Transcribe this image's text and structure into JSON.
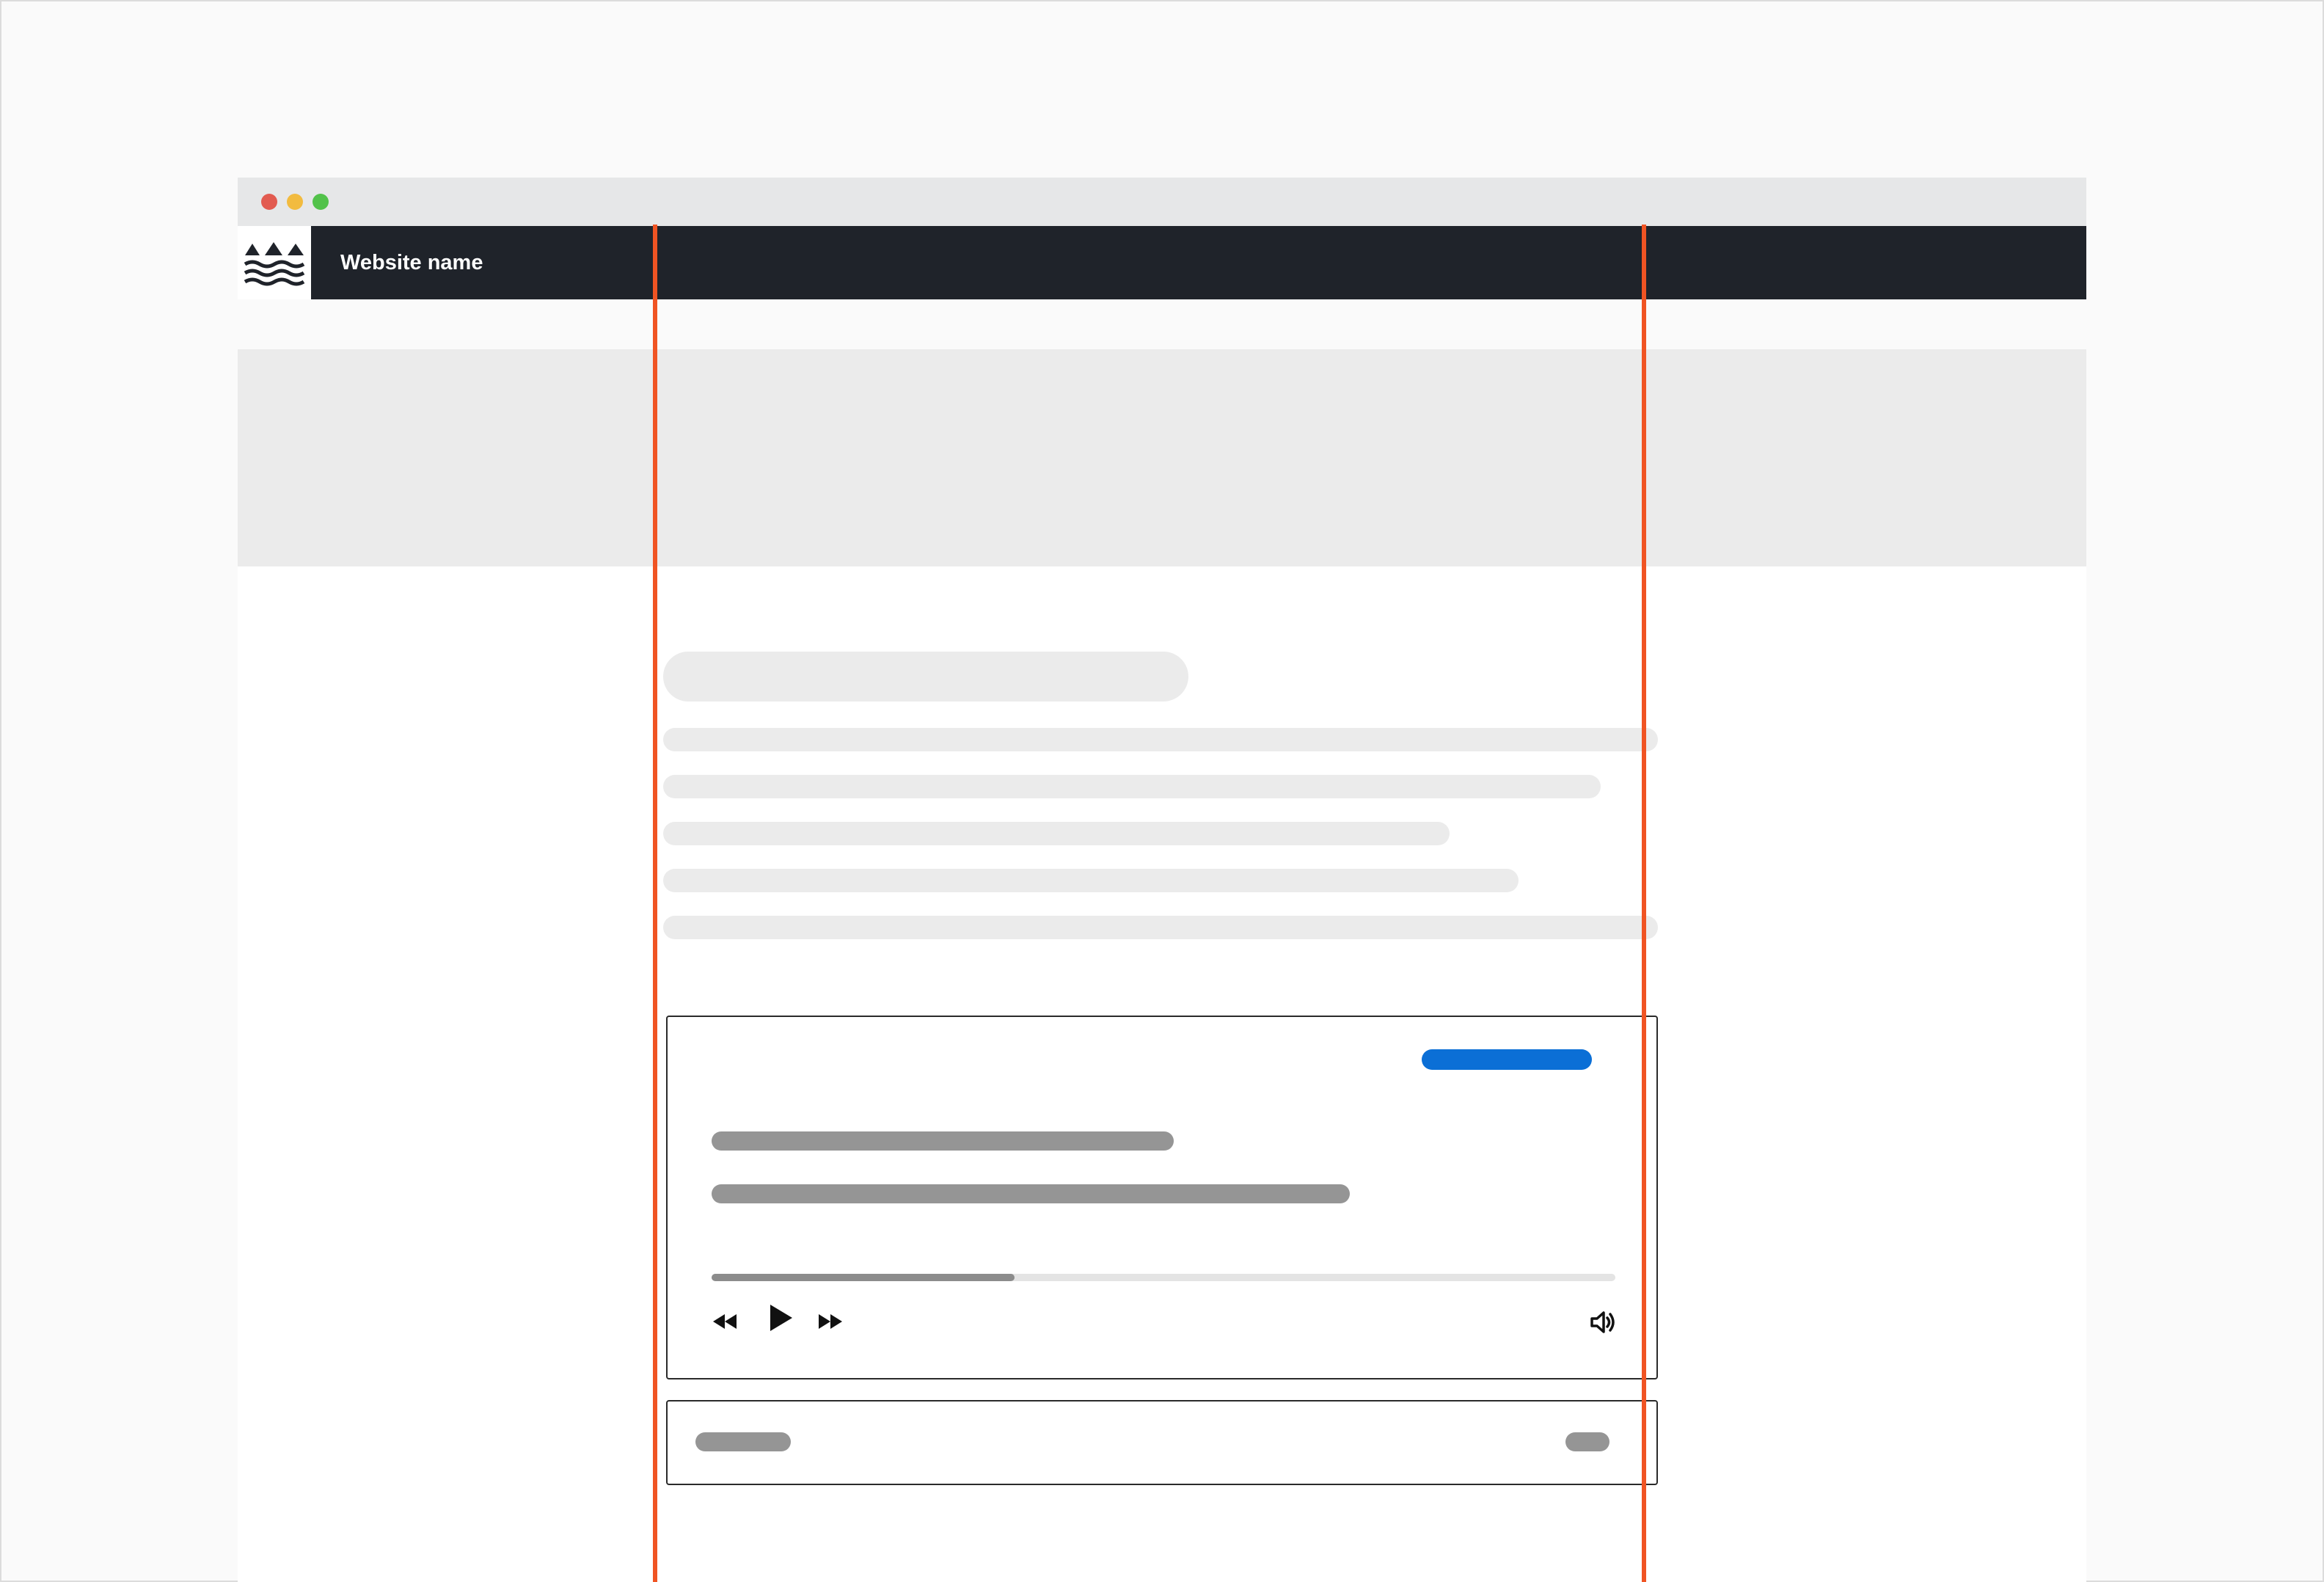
{
  "header": {
    "site_name": "Website name"
  },
  "icons": {
    "logo": "mountains-waves-logo-icon",
    "rewind": "rewind-icon",
    "play": "play-icon",
    "fast_forward": "fast-forward-icon",
    "volume": "volume-icon"
  },
  "player": {
    "progress_fraction": 0.335
  },
  "colors": {
    "accent_guide": "#f05423",
    "link_blue": "#0b6fd6",
    "header_bg": "#1f232a"
  }
}
